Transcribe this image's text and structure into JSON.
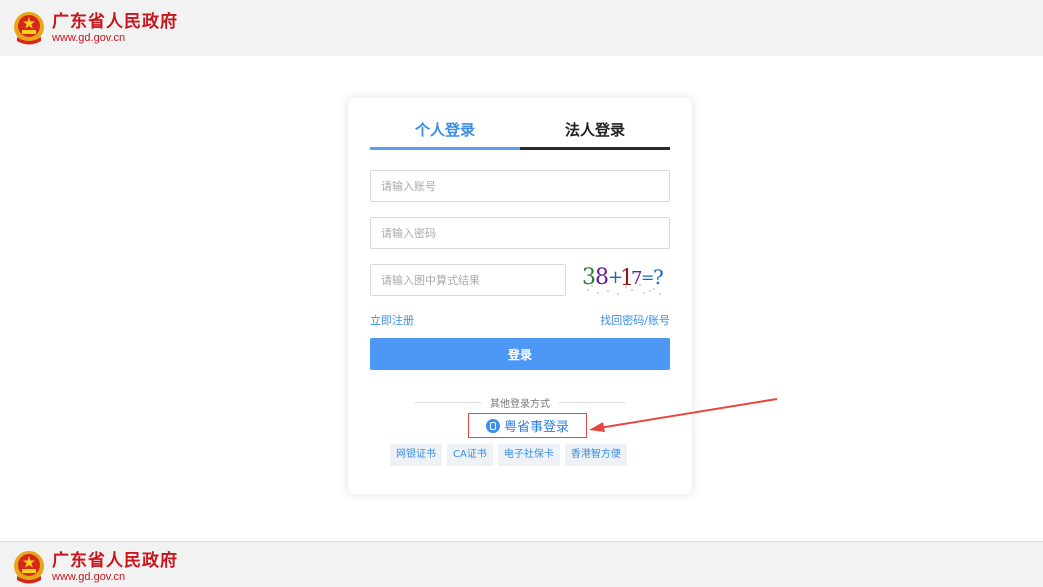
{
  "header": {
    "site_title": "广东省人民政府",
    "site_url": "www.gd.gov.cn"
  },
  "footer": {
    "site_title": "广东省人民政府",
    "site_url": "www.gd.gov.cn"
  },
  "login": {
    "tabs": [
      {
        "label": "个人登录",
        "active": true
      },
      {
        "label": "法人登录",
        "active": false
      }
    ],
    "account_input": {
      "placeholder": "请输入账号",
      "value": ""
    },
    "password_input": {
      "placeholder": "请输入密码",
      "value": ""
    },
    "captcha_input": {
      "placeholder": "请输入图中算式结果",
      "value": ""
    },
    "captcha_image_text": "38+17=?",
    "register_link": "立即注册",
    "recover_link": "找回密码/账号",
    "login_button": "登录",
    "other_methods_label": "其他登录方式",
    "yueshengshi_login": "粤省事登录",
    "methods": [
      "网银证书",
      "CA证书",
      "电子社保卡",
      "香港智方便"
    ]
  },
  "colors": {
    "accent_blue": "#4d98f4",
    "brand_red": "#c8161d",
    "highlight_red": "#e8463f"
  }
}
